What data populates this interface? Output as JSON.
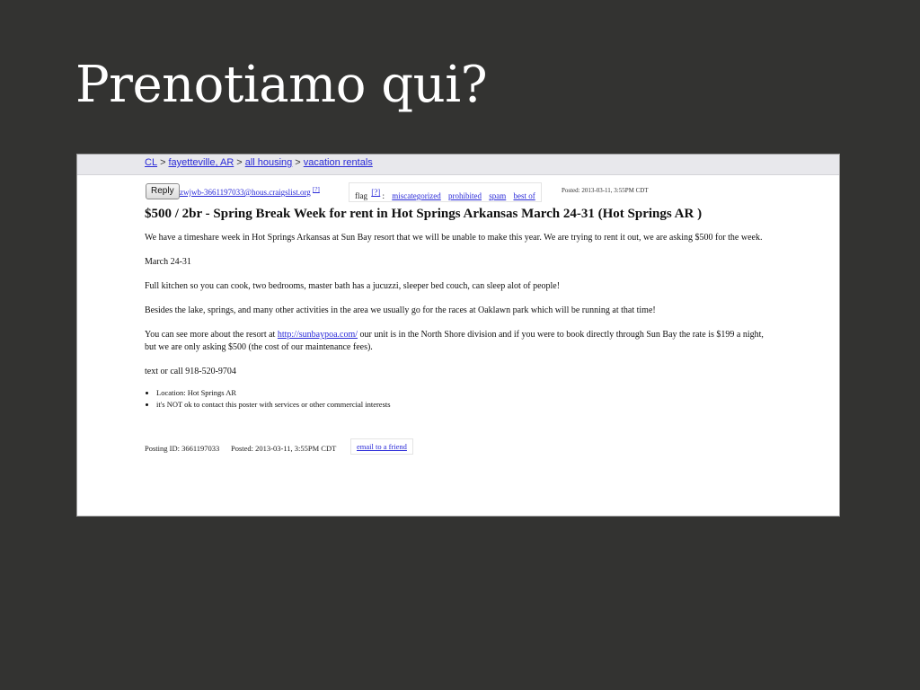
{
  "slide": {
    "title": "Prenotiamo qui?"
  },
  "breadcrumbs": [
    {
      "label": "CL"
    },
    {
      "label": "fayetteville, AR"
    },
    {
      "label": "all housing"
    },
    {
      "label": "vacation rentals"
    }
  ],
  "breadcrumb_separator": ">",
  "reply": {
    "button_label": "Reply",
    "email": "zwjwb-3661197033@hous.craigslist.org",
    "help_mark": "[?]"
  },
  "flag": {
    "label": "flag",
    "help_mark": "[?]",
    "colon": ":",
    "options": [
      "miscategorized",
      "prohibited",
      "spam",
      "best of"
    ]
  },
  "posted_top": "Posted: 2013-03-11, 3:55PM CDT",
  "post": {
    "title": "$500 / 2br - Spring Break Week for rent in Hot Springs Arkansas March 24-31 (Hot Springs AR )",
    "p1": "We have a timeshare week in Hot Springs Arkansas at Sun Bay resort that we will be unable to make this year. We are trying to rent it out, we are asking $500 for the week.",
    "p2": "March 24-31",
    "p3": "Full kitchen so you can cook, two bedrooms, master bath has a jucuzzi, sleeper bed couch, can sleep alot of people!",
    "p4": "Besides the lake, springs, and many other activities in the area we usually go for the races at Oaklawn park which will be running at that time!",
    "p5_before": "You can see more about the resort at ",
    "p5_link": "http://sunbaypoa.com/",
    "p5_after": " our unit is in the North Shore division and if you were to book directly through Sun Bay the rate is $199 a night, but we are only asking $500 (the cost of our maintenance fees).",
    "p6": "text or call 918-520-9704",
    "bullets": [
      "Location: Hot Springs AR",
      "it's NOT ok to contact this poster with services or other commercial interests"
    ]
  },
  "footer": {
    "posting_id": "Posting ID: 3661197033",
    "posted": "Posted: 2013-03-11, 3:55PM CDT",
    "email_friend": "email to a friend"
  }
}
